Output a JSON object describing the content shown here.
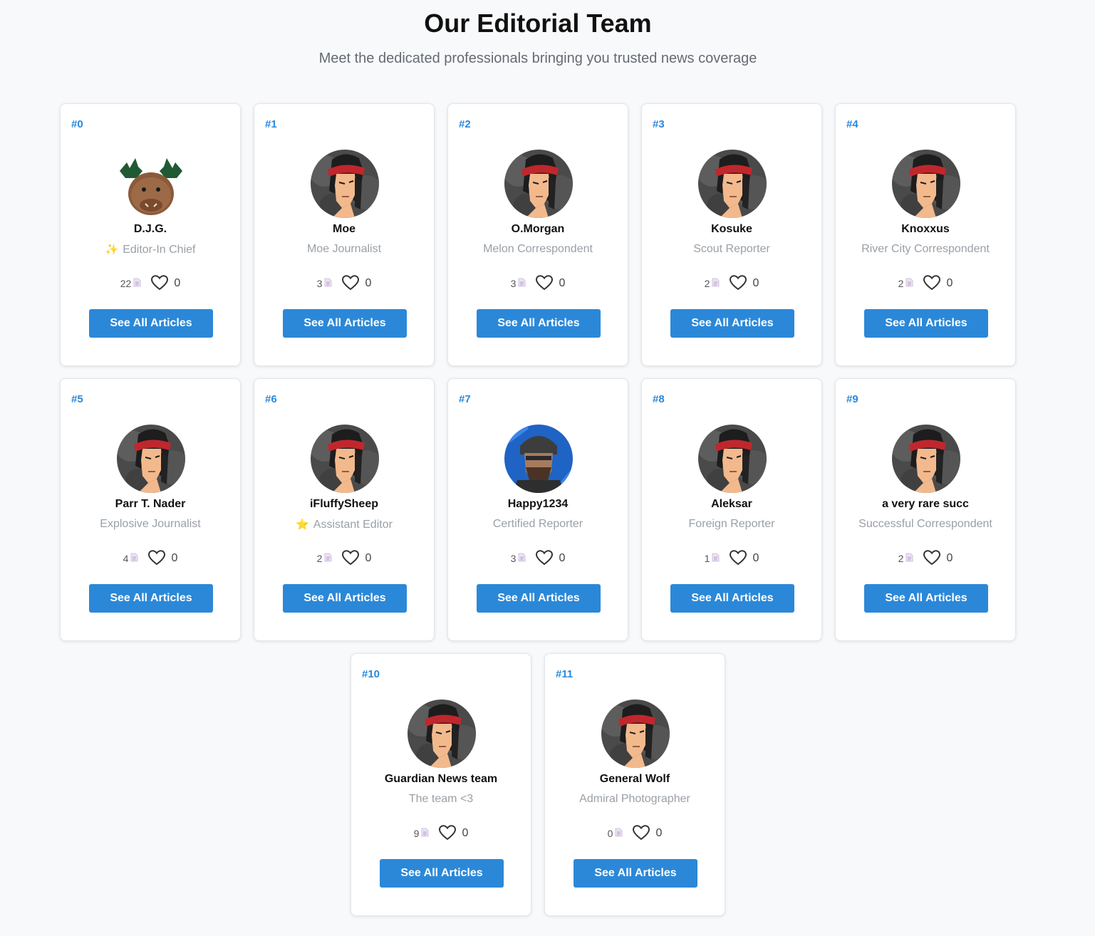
{
  "header": {
    "title": "Our Editorial Team",
    "subtitle": "Meet the dedicated professionals bringing you trusted news coverage"
  },
  "accent_color": "#2b88d8",
  "members": [
    {
      "rank": "#0",
      "name": "D.J.G.",
      "role": "Editor-In Chief",
      "role_icon": "sparkles-icon",
      "role_glyph": "✨",
      "articles": "22",
      "likes": "0",
      "button": "See All Articles",
      "avatar": "moose-plush-avatar"
    },
    {
      "rank": "#1",
      "name": "Moe",
      "role": "Moe Journalist",
      "role_icon": "",
      "role_glyph": "",
      "articles": "3",
      "likes": "0",
      "button": "See All Articles",
      "avatar": "bandana-warrior-avatar"
    },
    {
      "rank": "#2",
      "name": "O.Morgan",
      "role": "Melon Correspondent",
      "role_icon": "",
      "role_glyph": "",
      "articles": "3",
      "likes": "0",
      "button": "See All Articles",
      "avatar": "bandana-warrior-avatar"
    },
    {
      "rank": "#3",
      "name": "Kosuke",
      "role": "Scout Reporter",
      "role_icon": "",
      "role_glyph": "",
      "articles": "2",
      "likes": "0",
      "button": "See All Articles",
      "avatar": "bandana-warrior-avatar"
    },
    {
      "rank": "#4",
      "name": "Knoxxus",
      "role": "River City Correspondent",
      "role_icon": "",
      "role_glyph": "",
      "articles": "2",
      "likes": "0",
      "button": "See All Articles",
      "avatar": "bandana-warrior-avatar"
    },
    {
      "rank": "#5",
      "name": "Parr T. Nader",
      "role": "Explosive Journalist",
      "role_icon": "",
      "role_glyph": "",
      "articles": "4",
      "likes": "0",
      "button": "See All Articles",
      "avatar": "bandana-warrior-avatar"
    },
    {
      "rank": "#6",
      "name": "iFluffySheep",
      "role": "Assistant Editor",
      "role_icon": "star-icon",
      "role_glyph": "⭐",
      "articles": "2",
      "likes": "0",
      "button": "See All Articles",
      "avatar": "bandana-warrior-avatar"
    },
    {
      "rank": "#7",
      "name": "Happy1234",
      "role": "Certified Reporter",
      "role_icon": "",
      "role_glyph": "",
      "articles": "3",
      "likes": "0",
      "button": "See All Articles",
      "avatar": "helmet-soldier-avatar"
    },
    {
      "rank": "#8",
      "name": "Aleksar",
      "role": "Foreign Reporter",
      "role_icon": "",
      "role_glyph": "",
      "articles": "1",
      "likes": "0",
      "button": "See All Articles",
      "avatar": "bandana-warrior-avatar"
    },
    {
      "rank": "#9",
      "name": "a very rare succ",
      "role": "Successful Correspondent",
      "role_icon": "",
      "role_glyph": "",
      "articles": "2",
      "likes": "0",
      "button": "See All Articles",
      "avatar": "bandana-warrior-avatar"
    },
    {
      "rank": "#10",
      "name": "Guardian News team",
      "role": "The team <3",
      "role_icon": "",
      "role_glyph": "",
      "articles": "9",
      "likes": "0",
      "button": "See All Articles",
      "avatar": "bandana-warrior-avatar"
    },
    {
      "rank": "#11",
      "name": "General Wolf",
      "role": "Admiral Photographer",
      "role_icon": "",
      "role_glyph": "",
      "articles": "0",
      "likes": "0",
      "button": "See All Articles",
      "avatar": "bandana-warrior-avatar"
    }
  ]
}
